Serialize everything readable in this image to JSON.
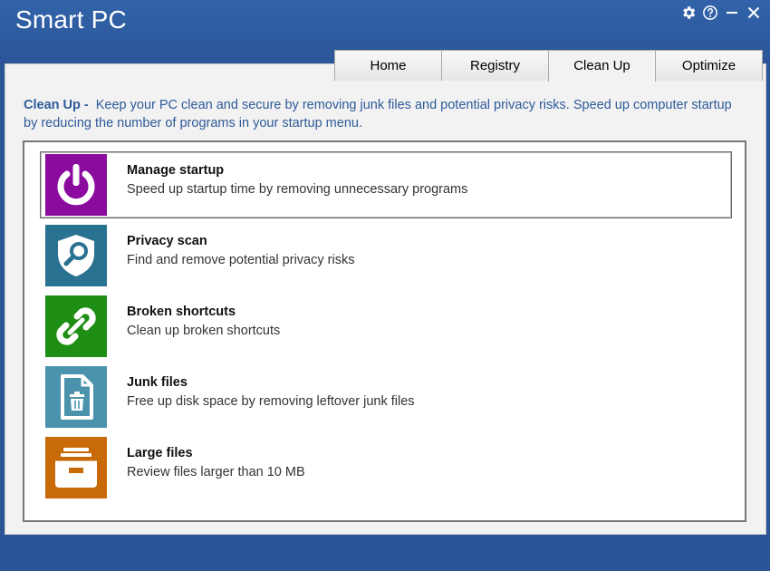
{
  "app": {
    "title": "Smart PC"
  },
  "tabs": [
    {
      "label": "Home"
    },
    {
      "label": "Registry"
    },
    {
      "label": "Clean Up",
      "active": true
    },
    {
      "label": "Optimize"
    }
  ],
  "description": {
    "label": "Clean Up -",
    "text": "Keep your PC clean and secure by removing junk files and potential privacy risks. Speed up computer startup by reducing the number of programs in your startup menu."
  },
  "items": [
    {
      "title": "Manage startup",
      "subtitle": "Speed up startup time by removing unnecessary programs",
      "icon": "power-icon",
      "color": "#8a0b9e",
      "selected": true
    },
    {
      "title": "Privacy scan",
      "subtitle": "Find and remove potential privacy risks",
      "icon": "shield-search-icon",
      "color": "#2a7291"
    },
    {
      "title": "Broken shortcuts",
      "subtitle": "Clean up broken shortcuts",
      "icon": "broken-link-icon",
      "color": "#1e8e14"
    },
    {
      "title": "Junk files",
      "subtitle": "Free up disk space by removing leftover junk files",
      "icon": "trash-document-icon",
      "color": "#4b93ac"
    },
    {
      "title": "Large files",
      "subtitle": "Review files larger than 10 MB",
      "icon": "drawer-icon",
      "color": "#c86a08"
    }
  ],
  "window_controls": [
    "gear-icon",
    "help-icon",
    "minimize-icon",
    "close-icon"
  ],
  "colors": {
    "titlebar": "#2c5598",
    "description_text": "#2e5a99"
  }
}
